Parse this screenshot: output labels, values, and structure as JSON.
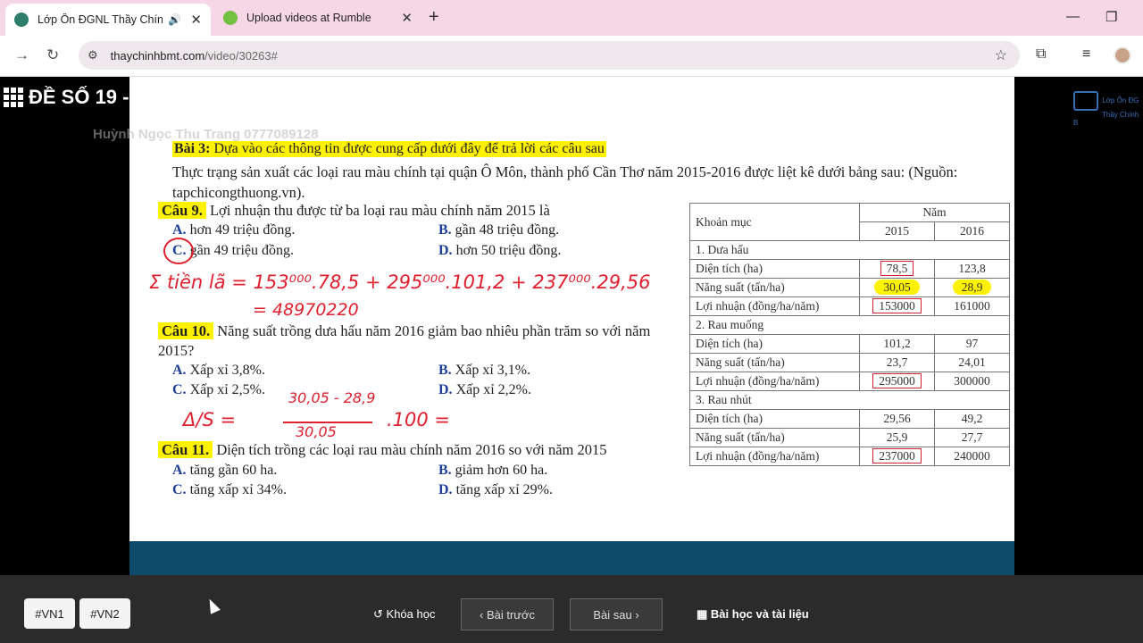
{
  "browser": {
    "tabs": [
      {
        "title": "Lớp Ôn ĐGNL Thầy Chính B",
        "active": true
      },
      {
        "title": "Upload videos at Rumble",
        "active": false
      }
    ],
    "url_host": "thaychinhbmt.com",
    "url_path": "/video/30263#"
  },
  "video": {
    "title": "ĐỀ SỐ 19 -",
    "watermark": "Huỳnh Ngọc Thu Trang 0777089128",
    "logo_line1": "Lớp Ôn ĐG",
    "logo_line2": "Thầy Chính B"
  },
  "slide": {
    "bai_label": "Bài 3:",
    "bai_text": "Dựa vào các thông tin được cung cấp dưới đây để trả lời các câu sau",
    "intro": "Thực trạng sản xuất các loại rau màu chính tại quận Ô Môn, thành phố Cần Thơ năm 2015-2016 được liệt kê dưới bảng sau: (Nguồn: tapchicongthuong.vn).",
    "q9": {
      "tag": "Câu 9.",
      "text": "Lợi nhuận thu được từ ba loại rau màu chính năm 2015 là",
      "A": "hơn 49 triệu đồng.",
      "B": "gần 48 triệu đồng.",
      "C": "gần 49 triệu đồng.",
      "D": "hơn 50 triệu đồng."
    },
    "q10": {
      "tag": "Câu 10.",
      "text": "Năng suất trồng dưa hấu năm 2016 giảm bao nhiêu phần trăm so với năm 2015?",
      "A": "Xấp xỉ 3,8%.",
      "B": "Xấp xỉ 3,1%.",
      "C": "Xấp xỉ 2,5%.",
      "D": "Xấp xỉ 2,2%."
    },
    "q11": {
      "tag": "Câu 11.",
      "text": "Diện tích trồng các loại rau màu chính năm 2016 so với năm 2015",
      "A": "tăng gần 60 ha.",
      "B": "giảm hơn 60 ha.",
      "C": "tăng xấp xỉ 34%.",
      "D": "tăng xấp xỉ 29%."
    },
    "handwriting": {
      "line1": "Σ tiền lã = 153⁰⁰⁰.78,5 + 295⁰⁰⁰.101,2 + 237⁰⁰⁰.29,56",
      "line2": "= 48970220",
      "line3": "Δ/S = ",
      "frac_num": "30,05 - 28,9",
      "frac_den": "30,05",
      "line3_tail": ".100 ="
    },
    "table": {
      "h_item": "Khoản mục",
      "h_year": "Năm",
      "y2015": "2015",
      "y2016": "2016",
      "sections": [
        {
          "name": "1. Dưa hấu",
          "rows": [
            {
              "label": "Diện tích (ha)",
              "v2015": "78,5",
              "v2016": "123,8"
            },
            {
              "label": "Năng suất (tấn/ha)",
              "v2015": "30,05",
              "v2016": "28,9"
            },
            {
              "label": "Lợi nhuận (đồng/ha/năm)",
              "v2015": "153000",
              "v2016": "161000"
            }
          ]
        },
        {
          "name": "2. Rau muống",
          "rows": [
            {
              "label": "Diện tích (ha)",
              "v2015": "101,2",
              "v2016": "97"
            },
            {
              "label": "Năng suất (tấn/ha)",
              "v2015": "23,7",
              "v2016": "24,01"
            },
            {
              "label": "Lợi nhuận (đồng/ha/năm)",
              "v2015": "295000",
              "v2016": "300000"
            }
          ]
        },
        {
          "name": "3. Rau nhút",
          "rows": [
            {
              "label": "Diện tích (ha)",
              "v2015": "29,56",
              "v2016": "49,2"
            },
            {
              "label": "Năng suất (tấn/ha)",
              "v2015": "25,9",
              "v2016": "27,7"
            },
            {
              "label": "Lợi nhuận (đồng/ha/năm)",
              "v2015": "237000",
              "v2016": "240000"
            }
          ]
        }
      ]
    }
  },
  "footer": {
    "tag1": "#VN1",
    "tag2": "#VN2",
    "course": "Khóa học",
    "prev": "Bài trước",
    "next": "Bài sau",
    "docs": "Bài học và tài liệu"
  }
}
